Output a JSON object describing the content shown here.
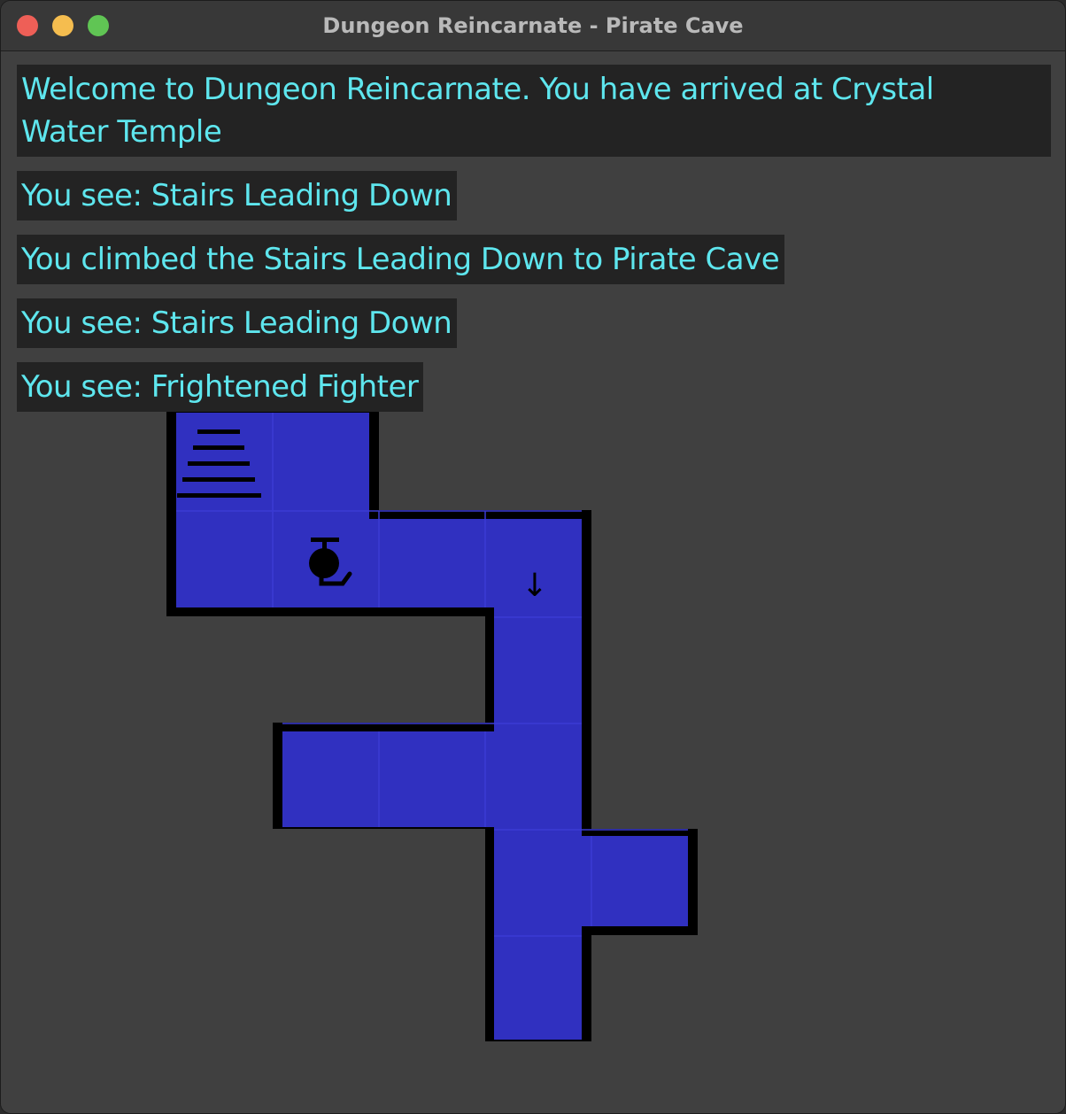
{
  "window": {
    "title": "Dungeon Reincarnate - Pirate Cave"
  },
  "messages": [
    "Welcome to Dungeon Reincarnate.  You have arrived at Crystal Water Temple",
    "You see: Stairs Leading Down",
    "You climbed the Stairs Leading Down to Pirate Cave",
    "You see: Stairs Leading Down",
    "You see: Frightened Fighter"
  ],
  "map": {
    "floor_color": "#3030c0",
    "wall_color": "#000000",
    "stairs_down_glyph": "↓",
    "icons": [
      "stairs-up-icon",
      "fighter-icon",
      "stairs-down-icon"
    ]
  }
}
